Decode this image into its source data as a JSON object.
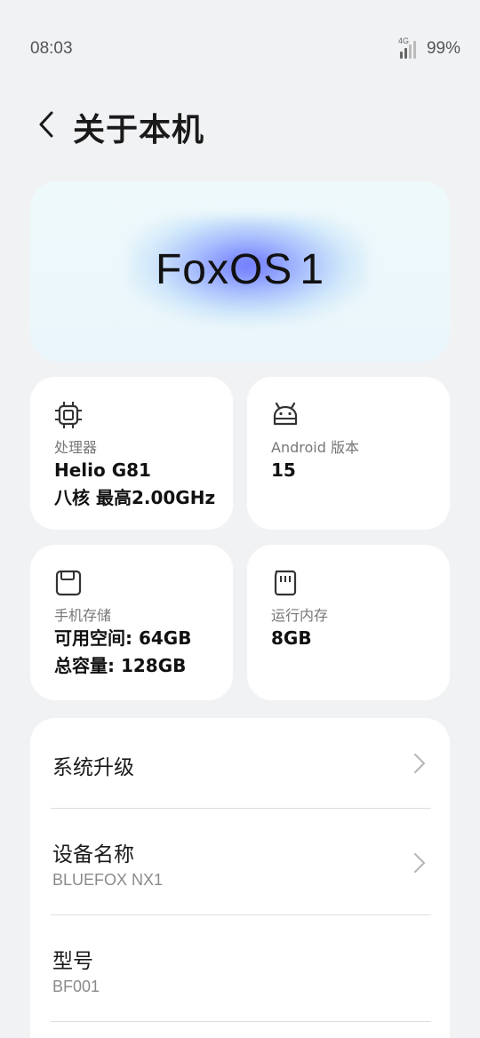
{
  "status_bar": {
    "time": "08:03",
    "network": "4G",
    "battery": "99%"
  },
  "header": {
    "back_icon": "chevron-left-icon",
    "title": "关于本机"
  },
  "banner": {
    "logo_text": "FoxOS",
    "logo_version": "1",
    "glow_color": "#5a5fff"
  },
  "cards": {
    "cpu": {
      "icon": "chip-icon",
      "label": "处理器",
      "line1": "Helio G81",
      "line2": "八核 最高2.00GHz"
    },
    "android": {
      "icon": "android-icon",
      "label": "Android 版本",
      "value": "15"
    },
    "storage": {
      "icon": "storage-icon",
      "label": "手机存储",
      "line1": "可用空间: 64GB",
      "line2": "总容量: 128GB"
    },
    "ram": {
      "icon": "memory-card-icon",
      "label": "运行内存",
      "value": "8GB"
    }
  },
  "list": {
    "items": [
      {
        "title": "系统升级",
        "chevron": "chevron-right-icon"
      },
      {
        "title": "设备名称",
        "subtitle": "BLUEFOX NX1",
        "chevron": "chevron-right-icon"
      },
      {
        "title": "型号",
        "subtitle": "BF001"
      }
    ]
  },
  "colors": {
    "background": "#f1f2f4",
    "card": "#ffffff",
    "text_primary": "#1a1a1a",
    "text_secondary": "#8a8a8a"
  }
}
